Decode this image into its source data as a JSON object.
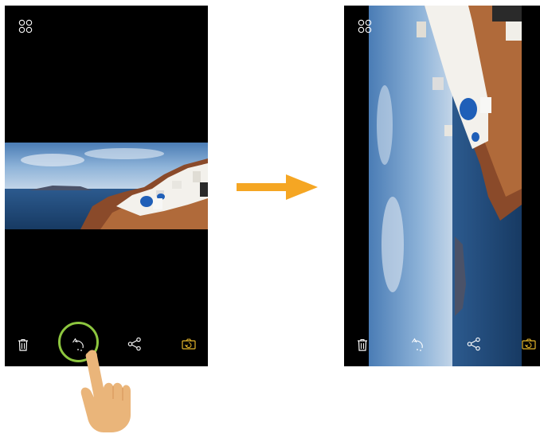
{
  "colors": {
    "phone_bg": "#000000",
    "icon_white": "#ffffff",
    "icon_gold": "#e3b52b",
    "highlight_ring": "#8dc63f",
    "arrow": "#f5a623",
    "hand": "#eab57a"
  },
  "left_screen": {
    "top_icon": "grid-dots-icon",
    "photo_orientation": "landscape",
    "toolbar": [
      "trash-icon",
      "rotate-icon",
      "share-icon",
      "auto-rotate-icon"
    ],
    "highlighted_control": "rotate-icon"
  },
  "right_screen": {
    "top_icon": "grid-dots-icon",
    "photo_orientation": "portrait-rotated",
    "toolbar": [
      "trash-icon",
      "rotate-icon",
      "share-icon",
      "auto-rotate-icon"
    ]
  },
  "transition": {
    "icon": "right-arrow-icon"
  },
  "gesture": {
    "icon": "pointing-hand-icon"
  }
}
